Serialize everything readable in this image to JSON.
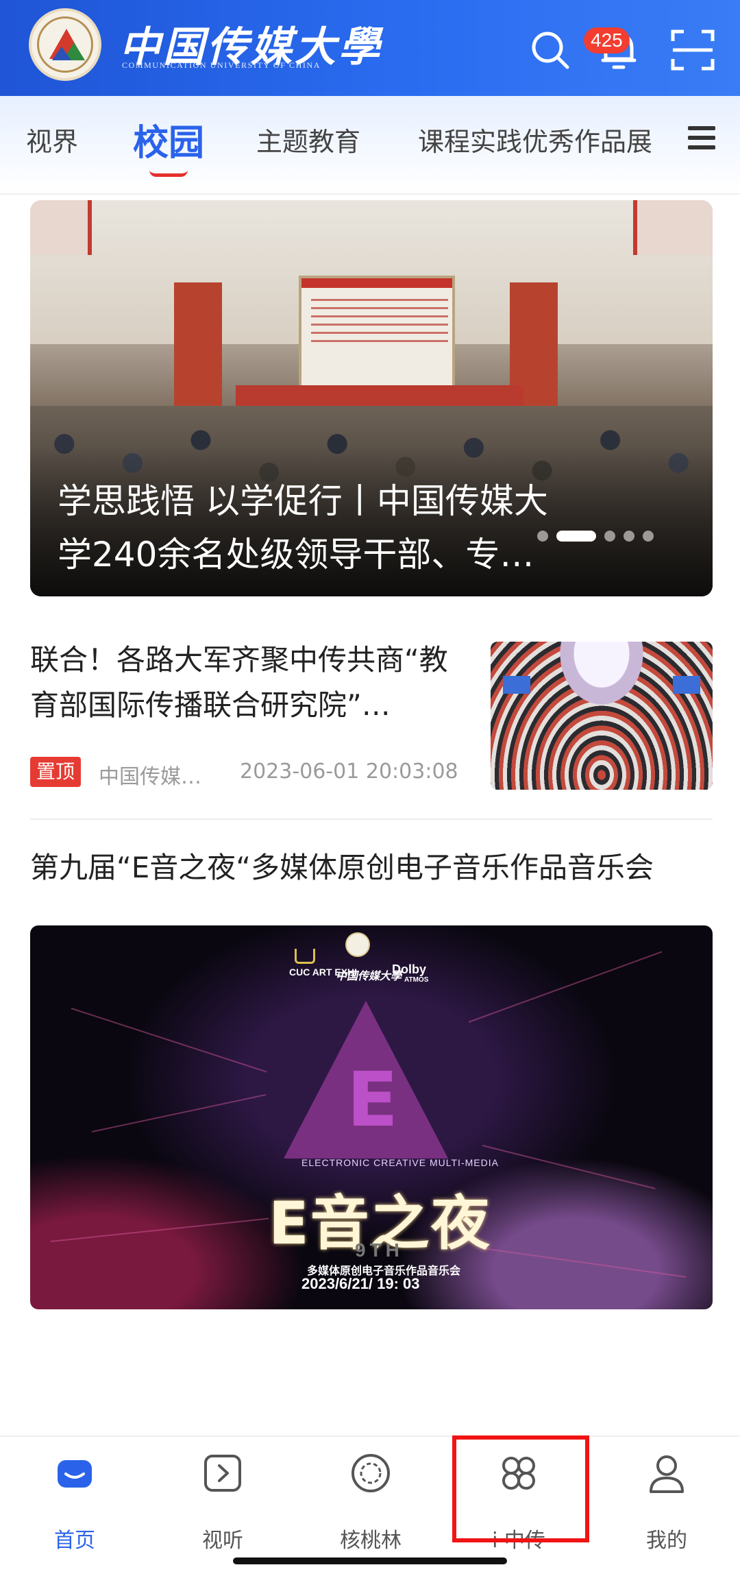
{
  "header": {
    "logo_cn": "中国传媒大學",
    "logo_en": "COMMUNICATION UNIVERSITY OF CHINA",
    "notification_count": "425",
    "icons": [
      "search-icon",
      "bell-icon",
      "scan-icon"
    ]
  },
  "tabs": {
    "items": [
      {
        "label": "视界"
      },
      {
        "label": "校园"
      },
      {
        "label": "主题教育"
      },
      {
        "label": "课程实践优秀作品展"
      }
    ],
    "active": "校园"
  },
  "hero": {
    "title": "学思践悟 以学促行丨中国传媒大学240余名处级领导干部、专…",
    "slides": 5,
    "active_slide": 2
  },
  "article1": {
    "title": "联合！各路大军齐聚中传共商“教育部国际传播联合研究院”…",
    "pin_label": "置顶",
    "source": "中国传媒…",
    "time": "2023-06-01 20:03:08"
  },
  "article2": {
    "title": "第九届“E音之夜“多媒体原创电子音乐作品音乐会",
    "poster": {
      "sponsor_1": "CUC ART EXHI",
      "sponsor_2": "中国传媒大學",
      "sponsor_3": "Dolby",
      "sponsor_3_sub": "ATMOS",
      "tagline": "ELECTRONIC CREATIVE MULTI-MEDIA",
      "main": "E音之夜",
      "edition": "9TH",
      "subtitle": "多媒体原创电子音乐作品音乐会",
      "date": "2023/6/21/ 19: 03"
    }
  },
  "bottom_nav": {
    "items": [
      {
        "label": "首页",
        "icon": "home-icon",
        "active": true
      },
      {
        "label": "视听",
        "icon": "play-icon",
        "active": false
      },
      {
        "label": "核桃林",
        "icon": "walnut-icon",
        "active": false
      },
      {
        "label": "i·中传",
        "icon": "apps-icon",
        "active": false
      },
      {
        "label": "我的",
        "icon": "person-icon",
        "active": false
      }
    ]
  },
  "colors": {
    "header_blue": "#2a62ea",
    "accent_red": "#e5302b",
    "highlight_red": "#f01414"
  }
}
